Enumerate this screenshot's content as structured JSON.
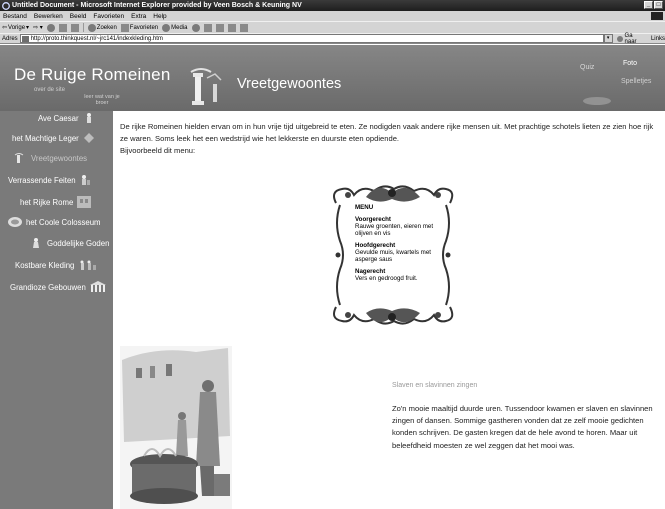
{
  "browser": {
    "title": "Untitled Document - Microsoft Internet Explorer provided by Veen Bosch & Keuning NV",
    "menu": [
      "Bestand",
      "Bewerken",
      "Beeld",
      "Favorieten",
      "Extra",
      "Help"
    ],
    "toolbar": {
      "back": "Vorige",
      "search": "Zoeken",
      "favorites": "Favorieten",
      "media": "Media"
    },
    "address_label": "Adres",
    "address_value": "http://proto.thinkquest.nl/~jrc141/indexkleding.htm",
    "go_label": "Ga naar",
    "links_label": "Links"
  },
  "header": {
    "site_title": "De Ruige Romeinen",
    "over_site": "over de site",
    "wat_leer": "leer wat van je broer",
    "section_title": "Vreetgewoontes",
    "quiz": "Quiz",
    "foto": "Foto",
    "spelletjes": "Spelletjes"
  },
  "sidebar": {
    "items": [
      {
        "label": "Ave Caesar",
        "icon": "statue-icon"
      },
      {
        "label": "het Machtige Leger",
        "icon": "shield-icon"
      },
      {
        "label": "Vreetgewoontes",
        "icon": "column-icon"
      },
      {
        "label": "Verrassende Feiten",
        "icon": "figure-icon"
      },
      {
        "label": "het Rijke Rome",
        "icon": "building-icon"
      },
      {
        "label": "het Coole Colosseum",
        "icon": "colosseum-icon"
      },
      {
        "label": "Goddelijke Goden",
        "icon": "god-icon"
      },
      {
        "label": "Kostbare Kleding",
        "icon": "clothing-icon"
      },
      {
        "label": "Grandioze Gebouwen",
        "icon": "temple-icon"
      }
    ]
  },
  "content": {
    "intro_1": "De rijke Romeinen hielden ervan om in hun vrije tijd uitgebreid te eten. Ze nodigden vaak andere rijke mensen uit. Met prachtige schotels lieten ze zien hoe rijk ze waren. Soms leek het een wedstrijd wie het lekkerste en duurste eten opdiende.",
    "intro_2": "Bijvoorbeeld dit menu:",
    "menu": {
      "title": "MENU",
      "courses": [
        {
          "name": "Voorgerecht",
          "dish": "Rauwe groenten, eieren met olijven en vis"
        },
        {
          "name": "Hoofdgerecht",
          "dish": "Gevulde muis, kwartels met asperge saus"
        },
        {
          "name": "Nagerecht",
          "dish": "Vers en gedroogd fruit."
        }
      ]
    },
    "slaves_title": "Slaven en slavinnen zingen",
    "slaves_body": "Zo'n mooie maaltijd duurde uren. Tussendoor kwamen er slaven en slavinnen zingen of dansen. Sommige gastheren vonden dat ze zelf mooie gedichten konden schrijven. De gasten kregen dat de hele avond te horen. Maar uit beleefdheid moesten ze wel zeggen dat het mooi was."
  }
}
